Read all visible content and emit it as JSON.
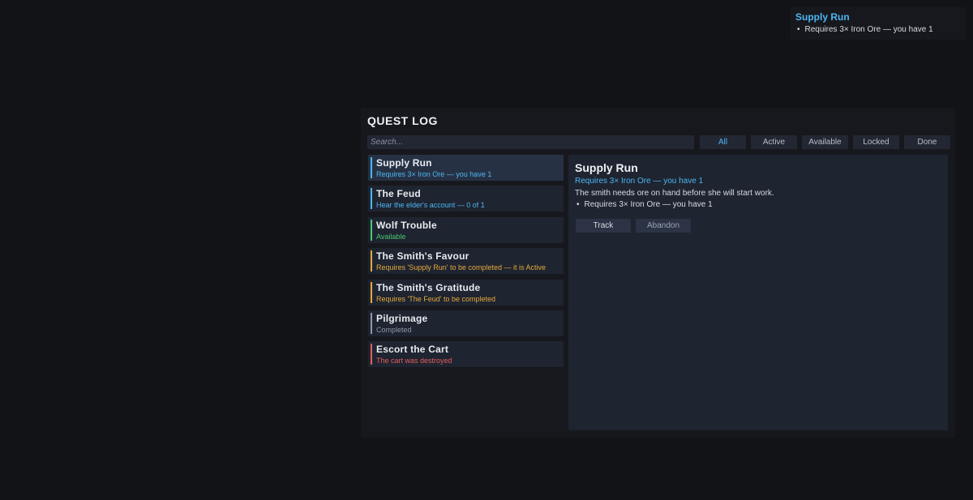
{
  "tracker": {
    "title": "Supply Run",
    "lines": [
      "Requires 3× Iron Ore — you have 1"
    ]
  },
  "quest_log": {
    "title": "QUEST LOG",
    "search_placeholder": "Search...",
    "filters": [
      {
        "label": "All",
        "active": true
      },
      {
        "label": "Active",
        "active": false
      },
      {
        "label": "Available",
        "active": false
      },
      {
        "label": "Locked",
        "active": false
      },
      {
        "label": "Done",
        "active": false
      }
    ],
    "quests": [
      {
        "name": "Supply Run",
        "status": "Requires 3× Iron Ore — you have 1",
        "color": "#4db6f2",
        "selected": true
      },
      {
        "name": "The Feud",
        "status": "Hear the elder's account — 0 of 1",
        "color": "#4db6f2",
        "selected": false
      },
      {
        "name": "Wolf Trouble",
        "status": "Available",
        "color": "#4cc870",
        "selected": false
      },
      {
        "name": "The Smith's Favour",
        "status": "Requires 'Supply Run' to be completed — it is Active",
        "color": "#e6a93c",
        "selected": false
      },
      {
        "name": "The Smith's Gratitude",
        "status": "Requires 'The Feud' to be completed",
        "color": "#e6a93c",
        "selected": false
      },
      {
        "name": "Pilgrimage",
        "status": "Completed",
        "color": "#8f98a8",
        "selected": false
      },
      {
        "name": "Escort the Cart",
        "status": "The cart was destroyed",
        "color": "#e35d5d",
        "selected": false
      }
    ],
    "details": {
      "title": "Supply Run",
      "requirement": "Requires 3× Iron Ore — you have 1",
      "description": "The smith needs ore on hand before she will start work.",
      "objectives": [
        "Requires 3× Iron Ore — you have 1"
      ],
      "track_label": "Track",
      "abandon_label": "Abandon"
    }
  },
  "bullet": "•"
}
